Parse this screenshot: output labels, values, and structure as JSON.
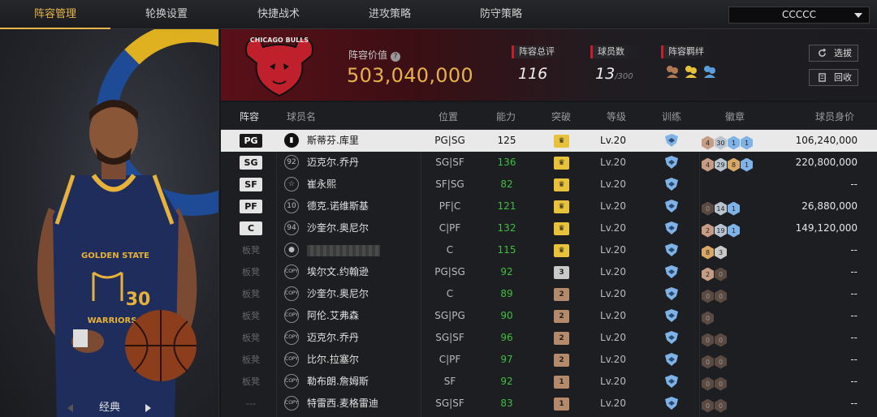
{
  "nav": {
    "tabs": [
      "阵容管理",
      "轮换设置",
      "快捷战术",
      "进攻策略",
      "防守策略"
    ],
    "team_select": "CCCCC"
  },
  "left": {
    "card_label": "经典",
    "jersey_team": "GOLDEN STATE",
    "jersey_number": "30",
    "jersey_city": "WARRIORS"
  },
  "header": {
    "logo_text": "CHICAGO BULLS",
    "value_label": "阵容价值",
    "value": "503,040,000",
    "rating_label": "阵容总评",
    "rating": "116",
    "players_label": "球员数",
    "players": "13",
    "players_max": "/300",
    "bond_label": "阵容羁绊",
    "btn_select": "选拔",
    "btn_recycle": "回收"
  },
  "table": {
    "headers": [
      "阵容",
      "球员名",
      "位置",
      "能力",
      "突破",
      "等级",
      "训练",
      "徽章",
      "球员身价"
    ],
    "rows": [
      {
        "slot": "PG",
        "icon": "bars",
        "name": "斯蒂芬.库里",
        "pos": "PG|SG",
        "ability": "125",
        "break": "crown",
        "level": "Lv.20",
        "badges": [
          "4",
          "30",
          "1",
          "1"
        ],
        "price": "106,240,000"
      },
      {
        "slot": "SG",
        "icon": "92",
        "name": "迈克尔.乔丹",
        "pos": "SG|SF",
        "ability": "136",
        "break": "crown",
        "level": "Lv.20",
        "badges": [
          "4",
          "29",
          "8",
          "1"
        ],
        "price": "220,800,000"
      },
      {
        "slot": "SF",
        "icon": "star",
        "name": "崔永熙",
        "pos": "SF|SG",
        "ability": "82",
        "break": "crown",
        "level": "Lv.20",
        "badges": [],
        "price": "--"
      },
      {
        "slot": "PF",
        "icon": "10",
        "name": "德克.诺维斯基",
        "pos": "PF|C",
        "ability": "121",
        "break": "crown",
        "level": "Lv.20",
        "badges": [
          "0",
          "14",
          "1"
        ],
        "price": "26,880,000"
      },
      {
        "slot": "C",
        "icon": "94",
        "name": "沙奎尔.奥尼尔",
        "pos": "C|PF",
        "ability": "132",
        "break": "crown",
        "level": "Lv.20",
        "badges": [
          "2",
          "19",
          "1"
        ],
        "price": "149,120,000"
      },
      {
        "slot": "板凳",
        "icon": "person",
        "name": "",
        "pos": "C",
        "ability": "115",
        "break": "crown",
        "level": "Lv.20",
        "badges": [
          "8",
          "3"
        ],
        "price": "--"
      },
      {
        "slot": "板凳",
        "icon": "COPY",
        "name": "埃尔文.约翰逊",
        "pos": "PG|SG",
        "ability": "92",
        "break": "3",
        "level": "Lv.20",
        "badges": [
          "2",
          "0"
        ],
        "price": "--"
      },
      {
        "slot": "板凳",
        "icon": "COPY",
        "name": "沙奎尔.奥尼尔",
        "pos": "C",
        "ability": "89",
        "break": "2",
        "level": "Lv.20",
        "badges": [
          "0",
          "0"
        ],
        "price": "--"
      },
      {
        "slot": "板凳",
        "icon": "COPY",
        "name": "阿伦.艾弗森",
        "pos": "SG|PG",
        "ability": "90",
        "break": "2",
        "level": "Lv.20",
        "badges": [
          "0"
        ],
        "price": "--"
      },
      {
        "slot": "板凳",
        "icon": "COPY",
        "name": "迈克尔.乔丹",
        "pos": "SG|SF",
        "ability": "96",
        "break": "2",
        "level": "Lv.20",
        "badges": [
          "0",
          "0"
        ],
        "price": "--"
      },
      {
        "slot": "板凳",
        "icon": "COPY",
        "name": "比尔.拉塞尔",
        "pos": "C|PF",
        "ability": "97",
        "break": "2",
        "level": "Lv.20",
        "badges": [
          "0",
          "0"
        ],
        "price": "--"
      },
      {
        "slot": "板凳",
        "icon": "COPY",
        "name": "勒布朗.詹姆斯",
        "pos": "SF",
        "ability": "92",
        "break": "1",
        "level": "Lv.20",
        "badges": [
          "0",
          "0"
        ],
        "price": "--"
      },
      {
        "slot": "---",
        "icon": "COPY",
        "name": "特雷西.麦格雷迪",
        "pos": "SG|SF",
        "ability": "83",
        "break": "1",
        "level": "Lv.20",
        "badges": [
          "0",
          "0"
        ],
        "price": "--"
      }
    ]
  }
}
